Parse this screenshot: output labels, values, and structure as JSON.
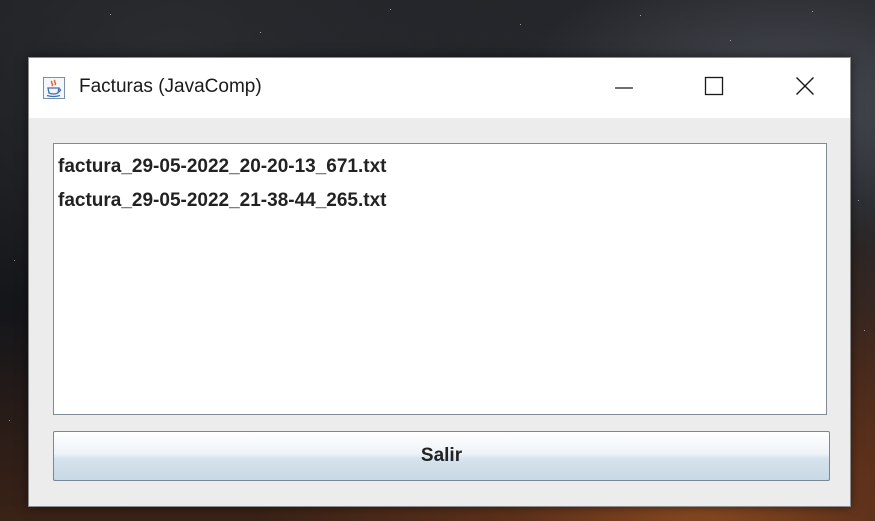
{
  "window": {
    "title": "Facturas (JavaComp)",
    "icon": "java-cup-icon",
    "controls": {
      "minimize_icon": "minimize-icon",
      "maximize_icon": "maximize-icon",
      "close_icon": "close-icon"
    }
  },
  "file_list": {
    "items": [
      {
        "label": "factura_29-05-2022_20-20-13_671.txt"
      },
      {
        "label": "factura_29-05-2022_21-38-44_265.txt"
      }
    ]
  },
  "actions": {
    "exit_label": "Salir"
  },
  "colors": {
    "titlebar_bg": "#ffffff",
    "window_bg": "#f0f0f0",
    "list_bg": "#ffffff",
    "list_border": "#7f8a96",
    "button_gradient_top": "#ffffff",
    "button_gradient_bottom": "#c8d8e6",
    "text": "#222222"
  }
}
